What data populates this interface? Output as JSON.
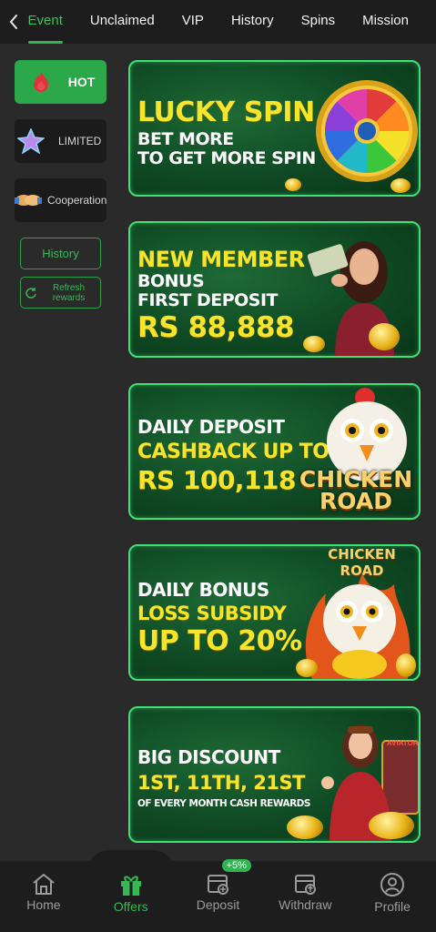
{
  "tabs": [
    "Event",
    "Unclaimed",
    "VIP",
    "History",
    "Spins",
    "Mission"
  ],
  "sidebar": {
    "categories": [
      {
        "label": "HOT",
        "icon": "fire-icon"
      },
      {
        "label": "LIMITED",
        "icon": "star-icon"
      },
      {
        "label": "Cooperation",
        "icon": "handshake-icon"
      }
    ],
    "history_label": "History",
    "refresh_label_1": "Refresh",
    "refresh_label_2": "rewards"
  },
  "banners": [
    {
      "line1": "LUCKY SPIN",
      "line2": "BET MORE",
      "line3": "TO GET MORE SPIN"
    },
    {
      "line1": "NEW MEMBER",
      "line2": "BONUS",
      "line3": "FIRST DEPOSIT",
      "line4": "RS 88,888"
    },
    {
      "line1": "DAILY DEPOSIT",
      "line2": "CASHBACK UP TO",
      "line3": "RS 100,118",
      "logo": "CHICKEN ROAD"
    },
    {
      "line1": "DAILY BONUS",
      "line2": "LOSS SUBSIDY",
      "line3": "UP TO 20%",
      "logo": "CHICKEN ROAD"
    },
    {
      "line1": "BIG DISCOUNT",
      "line2": "1ST, 11TH, 21ST",
      "line3": "OF EVERY MONTH CASH REWARDS",
      "logo": "AVIATOR"
    }
  ],
  "nav": [
    {
      "label": "Home",
      "icon": "home-icon"
    },
    {
      "label": "Offers",
      "icon": "gift-icon"
    },
    {
      "label": "Deposit",
      "icon": "deposit-icon",
      "badge": "+5%"
    },
    {
      "label": "Withdraw",
      "icon": "withdraw-icon"
    },
    {
      "label": "Profile",
      "icon": "profile-icon"
    }
  ],
  "colors": {
    "accent": "#2fb552",
    "banner_border": "#3fe074",
    "highlight_text": "#f6e52a",
    "background": "#2a2a2a"
  }
}
